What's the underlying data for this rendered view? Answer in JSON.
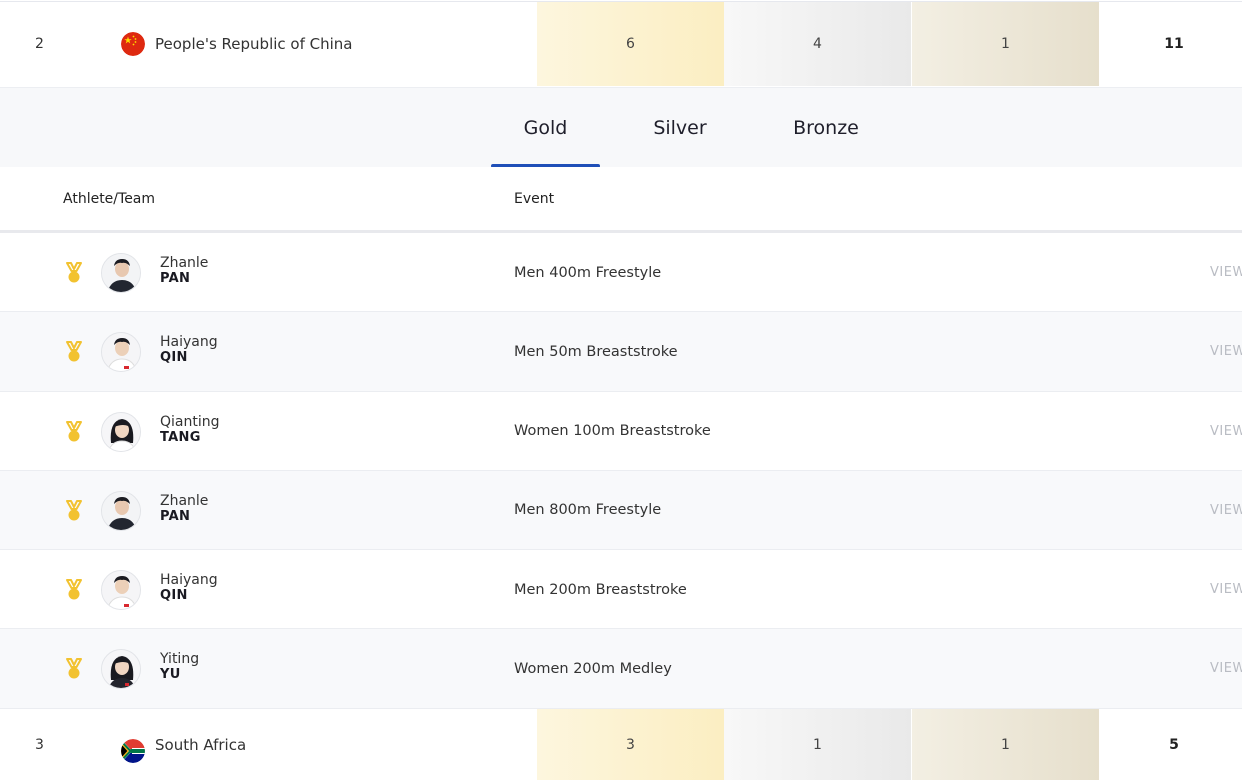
{
  "countries": [
    {
      "rank": "2",
      "name": "People's Republic of China",
      "gold": "6",
      "silver": "4",
      "bronze": "1",
      "total": "11",
      "flag_icon": "china-flag"
    },
    {
      "rank": "3",
      "name": "South Africa",
      "gold": "3",
      "silver": "1",
      "bronze": "1",
      "total": "5",
      "flag_icon": "south-africa-flag"
    }
  ],
  "tabs": [
    {
      "label": "Gold",
      "active": true
    },
    {
      "label": "Silver",
      "active": false
    },
    {
      "label": "Bronze",
      "active": false
    }
  ],
  "table": {
    "headers": {
      "athlete": "Athlete/Team",
      "event": "Event"
    },
    "view_label": "VIEW",
    "rows": [
      {
        "first": "Zhanle",
        "last": "PAN",
        "event": "Men 400m Freestyle",
        "avatar_icon": "male-athlete-avatar"
      },
      {
        "first": "Haiyang",
        "last": "QIN",
        "event": "Men 50m Breaststroke",
        "avatar_icon": "male-athlete-avatar"
      },
      {
        "first": "Qianting",
        "last": "TANG",
        "event": "Women 100m Breaststroke",
        "avatar_icon": "female-athlete-avatar"
      },
      {
        "first": "Zhanle",
        "last": "PAN",
        "event": "Men 800m Freestyle",
        "avatar_icon": "male-athlete-avatar"
      },
      {
        "first": "Haiyang",
        "last": "QIN",
        "event": "Men 200m Breaststroke",
        "avatar_icon": "male-athlete-avatar"
      },
      {
        "first": "Yiting",
        "last": "YU",
        "event": "Women 200m Medley",
        "avatar_icon": "female-athlete-avatar"
      }
    ]
  },
  "colors": {
    "accent": "#1f4fb8",
    "gold_medal": "#f2c230",
    "gold_cell": "#fbeec2",
    "silver_cell": "#e9e9e9",
    "bronze_cell": "#e6dfcc"
  }
}
